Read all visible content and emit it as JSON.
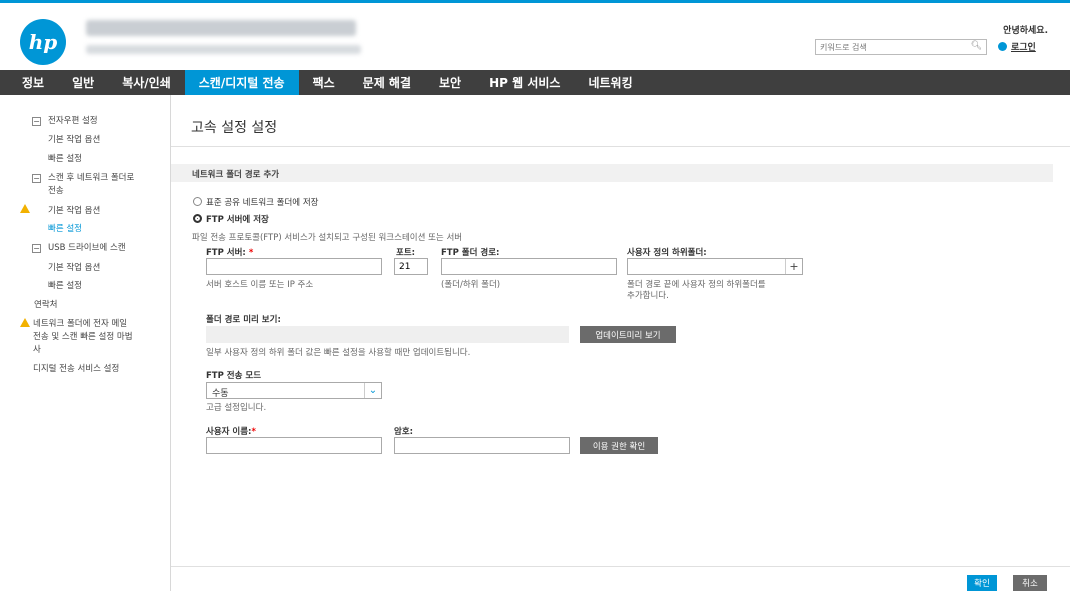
{
  "header": {
    "logo_text": "hp",
    "greeting": "안녕하세요.",
    "search_placeholder": "키워드로 검색",
    "login_label": "로그인"
  },
  "nav": {
    "items": [
      "정보",
      "일반",
      "복사/인쇄",
      "스캔/디지털 전송",
      "팩스",
      "문제 해결",
      "보안",
      "HP 웹 서비스",
      "네트워킹"
    ],
    "active_index": 3
  },
  "sidebar": {
    "items": [
      "전자우편 설정",
      "기본 작업 옵션",
      "빠른 설정",
      "스캔 후 네트워크 폴더로",
      "전송",
      "기본 작업 옵션",
      "빠른 설정",
      "USB 드라이브에 스캔",
      "기본 작업 옵션",
      "빠른 설정",
      "연락처",
      "네트워크 폴더에 전자 메일",
      "전송 및 스캔 빠른 설정 마법",
      "사",
      "디지털 전송 서비스 설정"
    ]
  },
  "main": {
    "title": "고속 설정 설정",
    "section_title": "네트워크 폴더 경로 추가",
    "radio_shared": "표준 공유 네트워크 폴더에 저장",
    "radio_ftp": "FTP 서버에 저장",
    "ftp_description": "파일 전송 프로토콜(FTP) 서비스가 설치되고 구성된 워크스테이션 또는 서버",
    "ftp_server_label": "FTP 서버:",
    "ftp_server_hint": "서버 호스트 이름 또는 IP 주소",
    "port_label": "포트:",
    "port_value": "21",
    "ftp_folder_label": "FTP 폴더 경로:",
    "ftp_folder_hint": "(폴더/하위 폴더)",
    "custom_subfolder_label": "사용자 정의 하위폴더:",
    "custom_subfolder_hint_1": "폴더 경로 끝에 사용자 정의 하위폴더를",
    "custom_subfolder_hint_2": "추가합니다.",
    "plus": "+",
    "preview_label": "폴더 경로 미리 보기:",
    "update_preview_button": "업데이트미리 보기",
    "preview_note": "일부 사용자 정의 하위 폴더 값은 빠른 설정을 사용할 때만 업데이트됩니다.",
    "transfer_mode_label": "FTP 전송 모드",
    "transfer_mode_value": "수동",
    "transfer_mode_hint": "고급 설정입니다.",
    "username_label": "사용자 이름:",
    "password_label": "암호:",
    "verify_access_button": "이용 권한 확인",
    "required_mark": "*"
  },
  "footer": {
    "ok_label": "확인",
    "cancel_label": "취소"
  },
  "colors": {
    "accent": "#0096d6",
    "nav_bg": "#3f3f3f",
    "warning": "#f2b100"
  }
}
